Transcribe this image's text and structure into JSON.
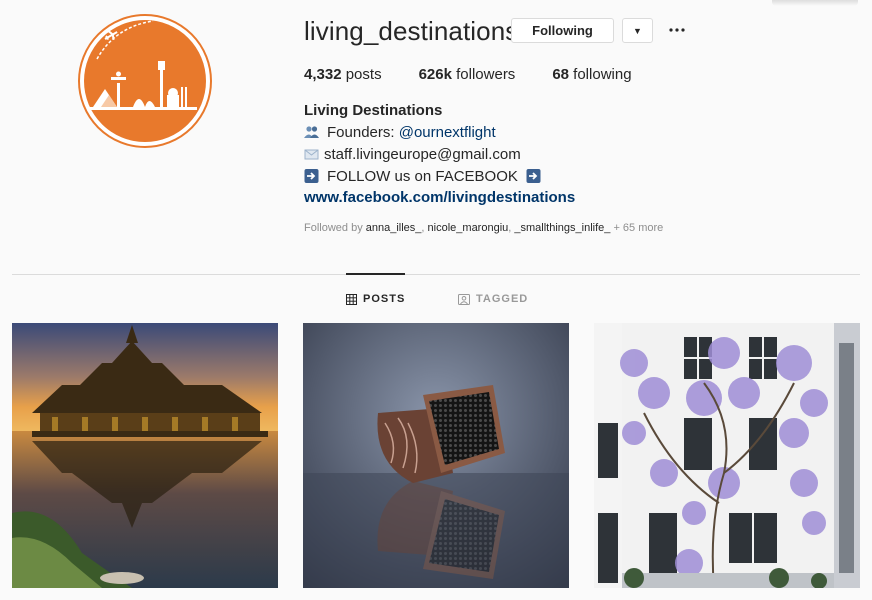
{
  "profile": {
    "username": "living_destinations",
    "following_button": "Following",
    "stats": {
      "posts_count": "4,332",
      "posts_label": "posts",
      "followers_count": "626k",
      "followers_label": "followers",
      "following_count": "68",
      "following_label": "following"
    },
    "full_name": "Living Destinations",
    "bio": {
      "line1_prefix": "Founders: ",
      "line1_mention": "@ournextflight",
      "line2": "staff.livingeurope@gmail.com",
      "line3": "FOLLOW us on FACEBOOK",
      "website": "www.facebook.com/livingdestinations"
    },
    "followed_by": {
      "prefix": "Followed by ",
      "user1": "anna_illes_",
      "sep1": ", ",
      "user2": "nicole_marongiu",
      "sep2": ", ",
      "user3": "_smallthings_inlife_",
      "more": " + 65 more"
    }
  },
  "tabs": {
    "posts": "POSTS",
    "tagged": "TAGGED"
  },
  "colors": {
    "brand_orange": "#e8792c",
    "link_blue": "#003569",
    "text_gray": "#8e8e8e"
  },
  "icons": [
    "airplane-icon",
    "people-icon",
    "envelope-icon",
    "arrow-right-icon",
    "chevron-down-icon",
    "more-dots-icon",
    "grid-icon",
    "tag-icon"
  ]
}
